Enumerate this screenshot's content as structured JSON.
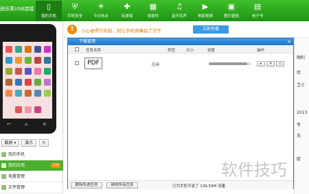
{
  "app": {
    "brand": "豌豆荚USB连接 ▾"
  },
  "nav": [
    {
      "label": "我的手机",
      "icon": "phone-icon",
      "glyph": "▯"
    },
    {
      "label": "手机安全",
      "icon": "shield-icon",
      "glyph": "⛨"
    },
    {
      "label": "今日热点",
      "icon": "sun-icon",
      "glyph": "☀"
    },
    {
      "label": "玩游戏",
      "icon": "gamepad-icon",
      "glyph": "✚"
    },
    {
      "label": "找软件",
      "icon": "apps-grid-icon",
      "glyph": "▦"
    },
    {
      "label": "音乐铃声",
      "icon": "music-note-icon",
      "glyph": "♫"
    },
    {
      "label": "电影视频",
      "icon": "film-icon",
      "glyph": "▶"
    },
    {
      "label": "图片壁纸",
      "icon": "image-icon",
      "glyph": "▣"
    },
    {
      "label": "电子书",
      "icon": "book-icon",
      "glyph": "▤"
    }
  ],
  "notice": {
    "text": "小心驶得万年船，别让手机病毒钻了空子",
    "button": "立即杀毒"
  },
  "left": {
    "btn_screenshot": "截屏 ▾",
    "btn_demo": "演示",
    "btn_refresh": "↻",
    "items": [
      {
        "label": "我的手机"
      },
      {
        "label": "我的应用",
        "badge": "135"
      },
      {
        "label": "电量管理"
      },
      {
        "label": "文件管理"
      }
    ]
  },
  "dialog": {
    "title": "下载管理",
    "close": "×",
    "columns": {
      "name": "任务名称",
      "type": "类型",
      "size": "大小",
      "progress": "进度",
      "actions": "操作"
    },
    "rows": [
      {
        "name": "PDF",
        "type": "应用",
        "size": "",
        "progress": 0.9,
        "action_play": "▸",
        "action_delete": "✕",
        "action_folder": "▭"
      }
    ],
    "footer": {
      "delete_btn": "删除所选任务",
      "continue_btn": "继续所有任务",
      "saved_text": "已为手机节省了 139.59M 流量"
    }
  },
  "rightpanel": {
    "lines": [
      "顺利",
      "欢",
      "卫士",
      "2013",
      "专",
      "氏",
      "欧"
    ]
  },
  "watermark": "软件技巧"
}
